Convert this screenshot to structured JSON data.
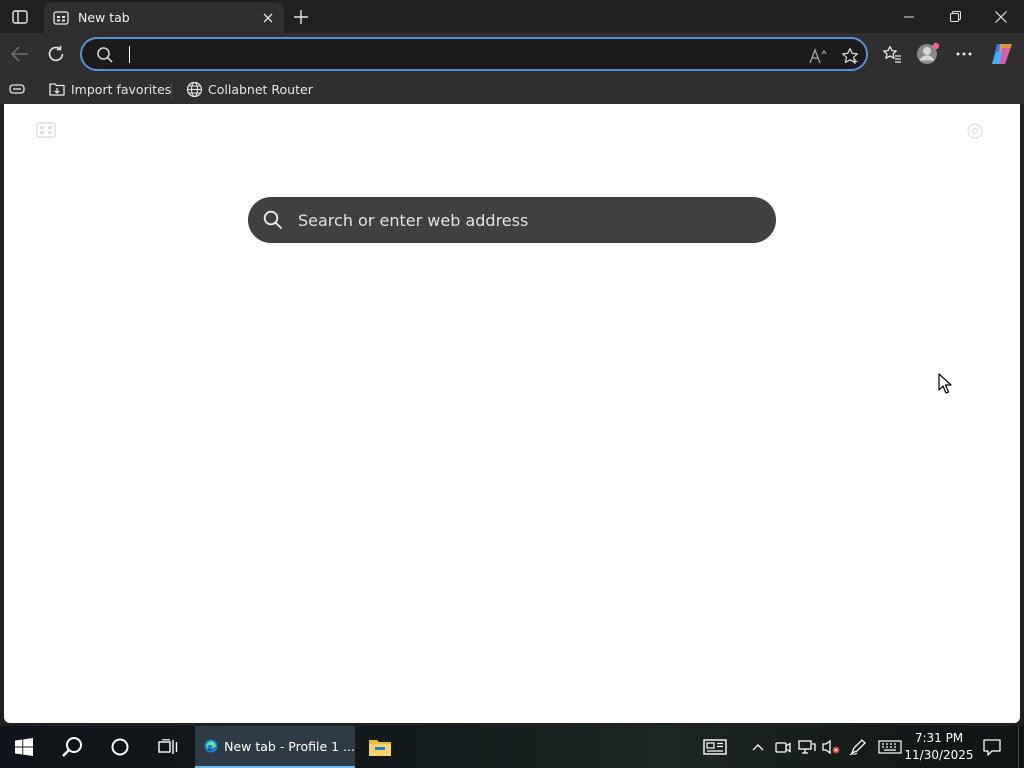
{
  "browser": {
    "tab": {
      "title": "New tab"
    },
    "address_bar": {
      "value": "",
      "placeholder": ""
    },
    "favorites": [
      {
        "label": "Import favorites",
        "icon": "import-favorites-icon"
      },
      {
        "label": "Collabnet Router",
        "icon": "globe-icon"
      }
    ]
  },
  "new_tab_page": {
    "search_placeholder": "Search or enter web address"
  },
  "taskbar": {
    "edge_button_label": "New tab - Profile 1 ...",
    "clock_time": "7:31 PM",
    "clock_date": "11/30/2025"
  },
  "colors": {
    "address_focus": "#5a8fd8",
    "ntp_search_bg": "#404040",
    "taskbar_active": "#76b9ed"
  }
}
